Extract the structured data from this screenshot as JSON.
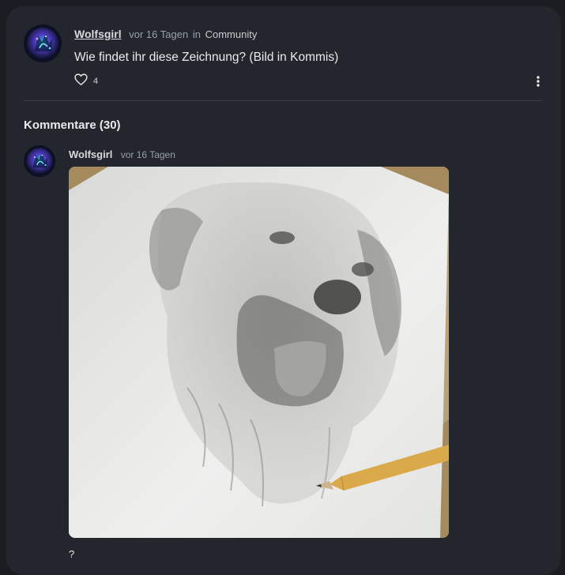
{
  "post": {
    "author": "Wolfsgirl",
    "time": "vor 16 Tagen",
    "in_label": "in",
    "community": "Community",
    "text": "Wie findet ihr diese Zeichnung? (Bild in Kommis)",
    "likes": "4"
  },
  "comments": {
    "heading": "Kommentare (30)",
    "items": [
      {
        "author": "Wolfsgirl",
        "time": "vor 16 Tagen",
        "text": "?"
      }
    ]
  },
  "icons": {
    "like": "heart-outline-icon",
    "more": "vertical-ellipsis-icon"
  },
  "colors": {
    "background": "#1a1d21",
    "card": "#23272d",
    "text": "#e8eaed",
    "muted": "#9aa0a6"
  }
}
